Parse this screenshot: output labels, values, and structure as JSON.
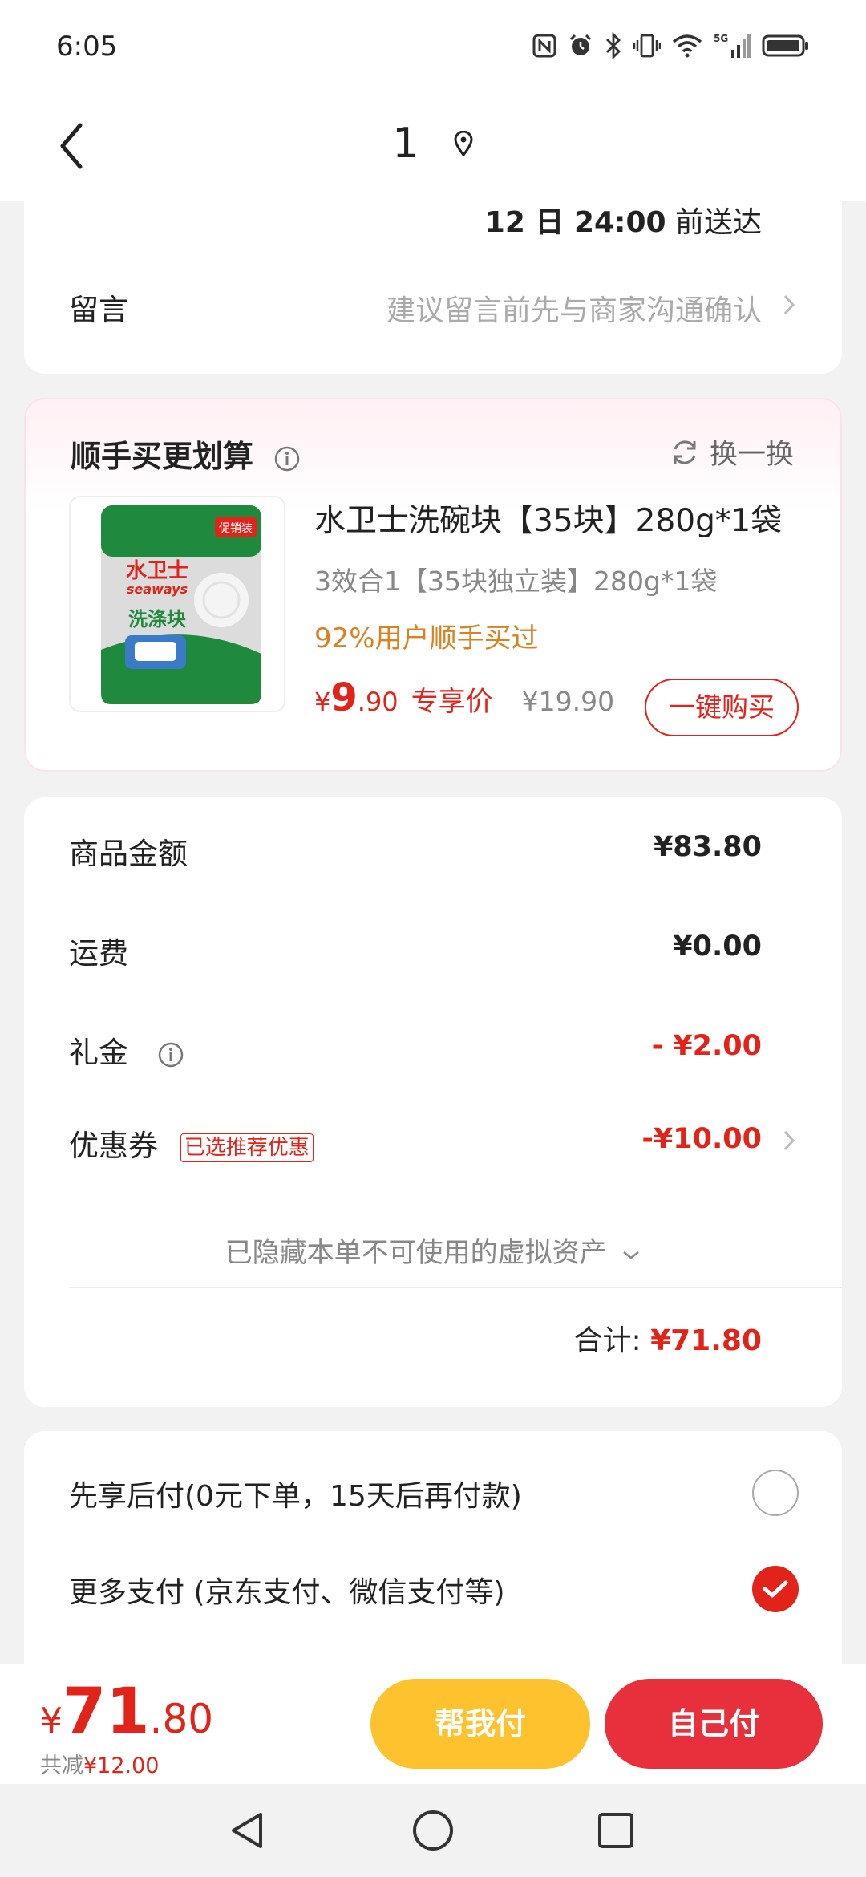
{
  "status_bar": {
    "time": "6:05",
    "icons": [
      "nfc-icon",
      "alarm-icon",
      "bluetooth-icon",
      "vibrate-icon",
      "wifi-icon",
      "signal-5g-icon",
      "battery-icon"
    ],
    "network": "5G"
  },
  "header": {
    "title": "1",
    "back_icon": "chevron-left-icon",
    "location_icon": "location-pin-icon"
  },
  "delivery": {
    "date_text": "12 日 24:00",
    "suffix": " 前送达",
    "message_label": "留言",
    "message_placeholder": "建议留言前先与商家沟通确认"
  },
  "upsell": {
    "title": "顺手买更划算",
    "swap_label": "换一换",
    "product": {
      "name": "水卫士洗碗块【35块】280g*1袋",
      "spec": "3效合1【35块独立装】280g*1袋",
      "social_proof": "92%用户顺手买过",
      "price_symbol": "¥",
      "price_int": "9",
      "price_dec": ".90",
      "price_tag": "专享价",
      "original_price": "¥19.90",
      "buy_label": "一键购买",
      "image_brand": "水卫士",
      "image_brand_en": "seaways",
      "image_label": "洗涤块",
      "image_badge": "促销装"
    }
  },
  "summary": {
    "rows": [
      {
        "label": "商品金额",
        "value": "¥83.80"
      },
      {
        "label": "运费",
        "value": "¥0.00"
      },
      {
        "label": "礼金",
        "value": "- ¥2.00"
      },
      {
        "label": "优惠券",
        "value": "-¥10.00",
        "badge": "已选推荐优惠"
      }
    ],
    "hidden_assets": "已隐藏本单不可使用的虚拟资产",
    "total_label": "合计:",
    "total_value": "¥71.80"
  },
  "payment": {
    "options": [
      {
        "label": "先享后付(0元下单，15天后再付款)",
        "selected": false
      },
      {
        "label": "更多支付 (京东支付、微信支付等)",
        "selected": true
      }
    ]
  },
  "bottom_bar": {
    "total_symbol": "¥",
    "total_int": "71",
    "total_dec": ".80",
    "saved_label": "共减",
    "saved_amount": "¥12.00",
    "help_pay_label": "帮我付",
    "self_pay_label": "自己付"
  },
  "colors": {
    "accent_red": "#e2231a",
    "help_pay_yellow": "#fdc22e",
    "self_pay_red": "#e8303c",
    "social_orange": "#d9821f"
  }
}
